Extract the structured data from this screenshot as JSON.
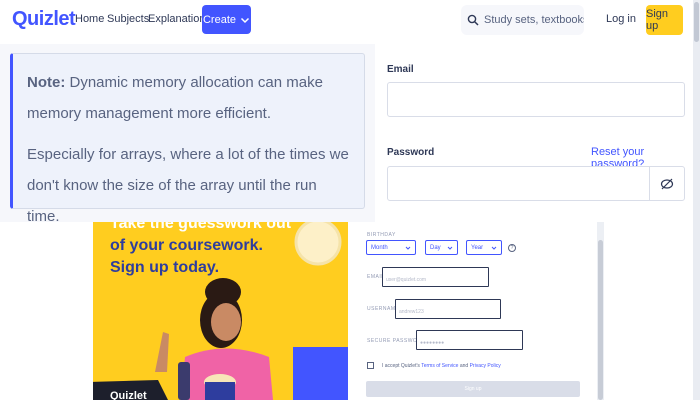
{
  "nav": {
    "logo": "Quizlet",
    "links": [
      "Home",
      "Subjects",
      "Explanations"
    ],
    "create_label": "Create",
    "search_placeholder": "Study sets, textbooks, ...",
    "login_label": "Log in",
    "signup_label": "Sign up"
  },
  "note": {
    "heading": "Note:",
    "text": "Dynamic memory allocation can make memory management more efficient.",
    "detail": "Especially for arrays, where a lot of the times we don't know the size of the array until the run time."
  },
  "login_form": {
    "email_label": "Email",
    "password_label": "Password",
    "reset_link": "Reset your password?",
    "email_value": "",
    "password_value": ""
  },
  "promo": {
    "headline_line1": "Take the guesswork out",
    "headline_line2": "of your coursework.",
    "headline_line3": "Sign up today.",
    "brand": "Quizlet"
  },
  "signup_modal": {
    "birthday_label": "BIRTHDAY",
    "month_label": "Month",
    "day_label": "Day",
    "year_label": "Year",
    "help_glyph": "?",
    "email_label": "EMAIL",
    "email_placeholder": "user@quizlet.com",
    "username_label": "USERNAME",
    "username_placeholder": "andrew123",
    "password_label": "SECURE PASSWORD",
    "password_placeholder": "●●●●●●●●",
    "terms_prefix": "I accept Quizlet's",
    "terms_link": "Terms of Service",
    "terms_and": "and",
    "privacy_link": "Privacy Policy",
    "submit_label": "Sign up"
  },
  "colors": {
    "brand_blue": "#4255ff",
    "brand_yellow": "#ffcd1f",
    "text_dark": "#2e3856",
    "note_bg": "#eef2fb"
  },
  "icons": [
    "search-icon",
    "chevron-down-icon",
    "eye-off-icon",
    "help-icon"
  ]
}
